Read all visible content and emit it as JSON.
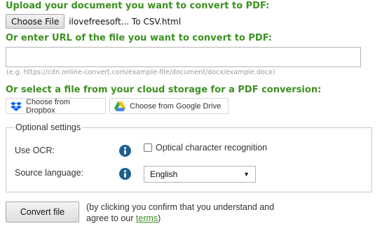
{
  "upload": {
    "heading": "Upload your document you want to convert to PDF:",
    "choose_file_label": "Choose File",
    "file_name": "ilovefreesoft... To CSV.html"
  },
  "url": {
    "heading": "Or enter URL of the file you want to convert to PDF:",
    "value": "",
    "hint": "(e.g. https://cdn.online-convert.com/example-file/document/docx/example.docx)"
  },
  "cloud": {
    "heading": "Or select a file from your cloud storage for a PDF conversion:",
    "dropbox_label": "Choose from Dropbox",
    "dropbox_icon": "dropbox-icon",
    "gdrive_label": "Choose from Google Drive",
    "gdrive_icon": "google-drive-icon"
  },
  "options": {
    "legend": "Optional settings",
    "ocr_label": "Use OCR:",
    "ocr_checkbox_label": "Optical character recognition",
    "ocr_checked": false,
    "language_label": "Source language:",
    "language_selected": "English",
    "info_icon": "info-icon"
  },
  "submit": {
    "convert_label": "Convert file",
    "confirm_line1": "(by clicking you confirm that you understand and",
    "confirm_line2_prefix": "agree to our ",
    "terms_link": "terms",
    "confirm_line2_suffix": ")"
  },
  "colors": {
    "heading_green": "#3c9120",
    "info_icon_blue": "#1e5f8e",
    "dropbox_blue": "#0061ff"
  }
}
